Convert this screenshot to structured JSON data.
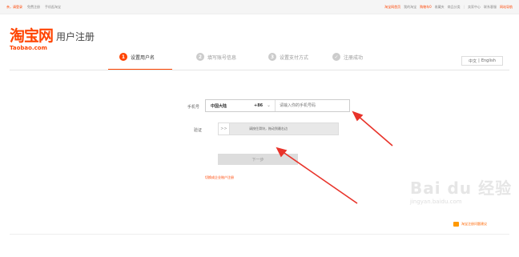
{
  "topbar": {
    "login": "亲，请登录",
    "register": "免费注册",
    "mobile": "手机逛淘宝",
    "home": "淘宝网首页",
    "my_taobao": "我的淘宝",
    "cart": "购物车0",
    "favorites": "收藏夹",
    "categories": "商品分类",
    "seller_center": "卖家中心",
    "contact": "联系客服",
    "site_nav": "网站导航"
  },
  "header": {
    "logo": "淘宝网",
    "logo_sub": "Taobao.com",
    "title": "用户注册"
  },
  "steps": [
    {
      "num": "1",
      "label": "设置用户名"
    },
    {
      "num": "2",
      "label": "填写账号信息"
    },
    {
      "num": "3",
      "label": "设置支付方式"
    },
    {
      "num": "✓",
      "label": "注册成功"
    }
  ],
  "lang": {
    "current": "中文",
    "other": "English"
  },
  "form": {
    "phone_label": "手机号",
    "country": "中国大陆",
    "code": "+86",
    "phone_placeholder": "请输入你的手机号码",
    "verify_label": "验证",
    "slider_handle": ">>",
    "slider_text": "请按住滑块，拖动到最右边",
    "next": "下一步",
    "enterprise": "切换成企业账户注册"
  },
  "watermark": {
    "brand": "Bai du 经验",
    "sub": "jingyan.baidu.com"
  },
  "feedback": "淘宝注册问题建议",
  "colors": {
    "accent": "#ff4400",
    "arrow": "#e8332a"
  }
}
